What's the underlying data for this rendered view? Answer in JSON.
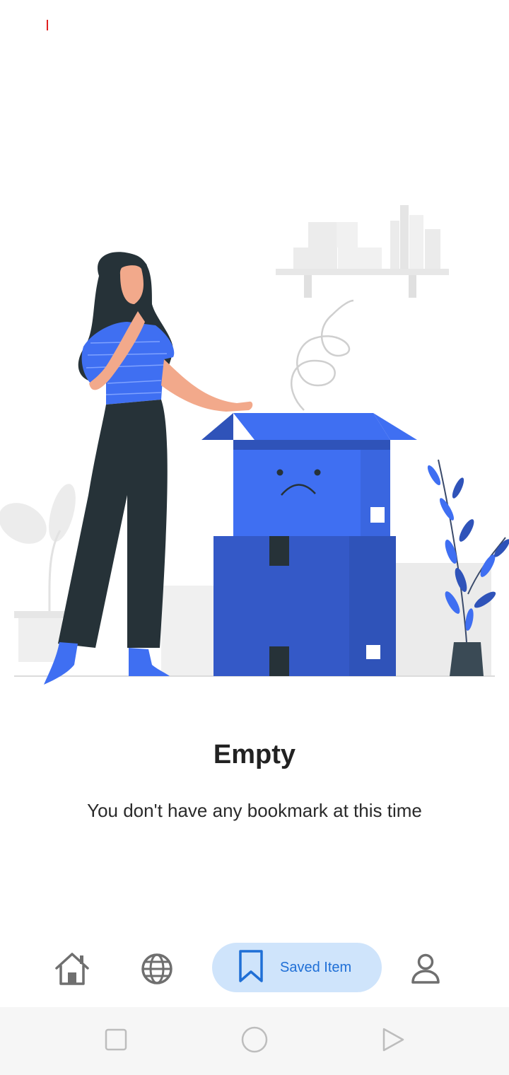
{
  "empty_state": {
    "title": "Empty",
    "message": "You don't have any bookmark at this time"
  },
  "bottom_nav": {
    "items": [
      {
        "id": "home",
        "icon": "home-icon",
        "active": false
      },
      {
        "id": "explore",
        "icon": "globe-icon",
        "active": false
      },
      {
        "id": "saved",
        "icon": "bookmark-icon",
        "label": "Saved Item",
        "active": true
      },
      {
        "id": "profile",
        "icon": "person-icon",
        "active": false
      }
    ]
  },
  "system_nav": {
    "buttons": [
      "recents-icon",
      "home-circle-icon",
      "back-triangle-icon"
    ]
  },
  "colors": {
    "accent": "#1f6fd6",
    "active_pill": "#cfe4fb",
    "box_blue": "#3f6ff2",
    "box_dark_blue": "#2f53b9",
    "title_text": "#222222",
    "icon_gray": "#6f6f6f"
  }
}
